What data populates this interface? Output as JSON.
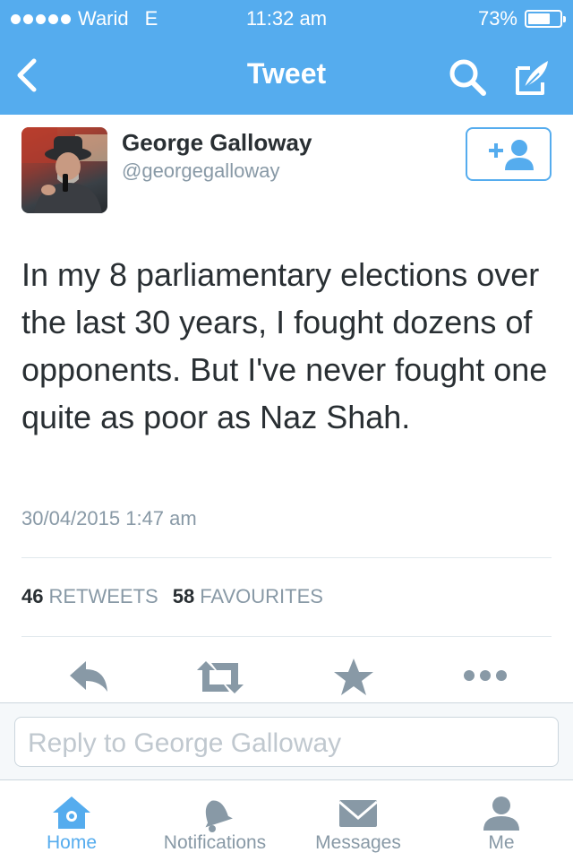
{
  "status_bar": {
    "carrier": "Warid",
    "network": "E",
    "time": "11:32 am",
    "battery": "73%",
    "battery_level": 0.73
  },
  "nav": {
    "title": "Tweet"
  },
  "author": {
    "name": "George Galloway",
    "handle": "@georgegalloway"
  },
  "tweet": {
    "text": "In my 8 parliamentary elections over the last 30 years, I fought dozens of opponents. But I've never fought one quite as poor as Naz Shah.",
    "timestamp": "30/04/2015 1:47 am"
  },
  "stats": {
    "retweets_count": "46",
    "retweets_label": "RETWEETS",
    "favourites_count": "58",
    "favourites_label": "FAVOURITES"
  },
  "reply": {
    "placeholder": "Reply to George Galloway"
  },
  "tabs": [
    {
      "label": "Home",
      "icon": "home-icon",
      "active": true
    },
    {
      "label": "Notifications",
      "icon": "bell-icon"
    },
    {
      "label": "Messages",
      "icon": "envelope-icon"
    },
    {
      "label": "Me",
      "icon": "person-icon"
    }
  ],
  "colors": {
    "accent": "#55acee",
    "muted": "#8899a6",
    "text": "#292f33",
    "action_icon": "#8899a6"
  }
}
